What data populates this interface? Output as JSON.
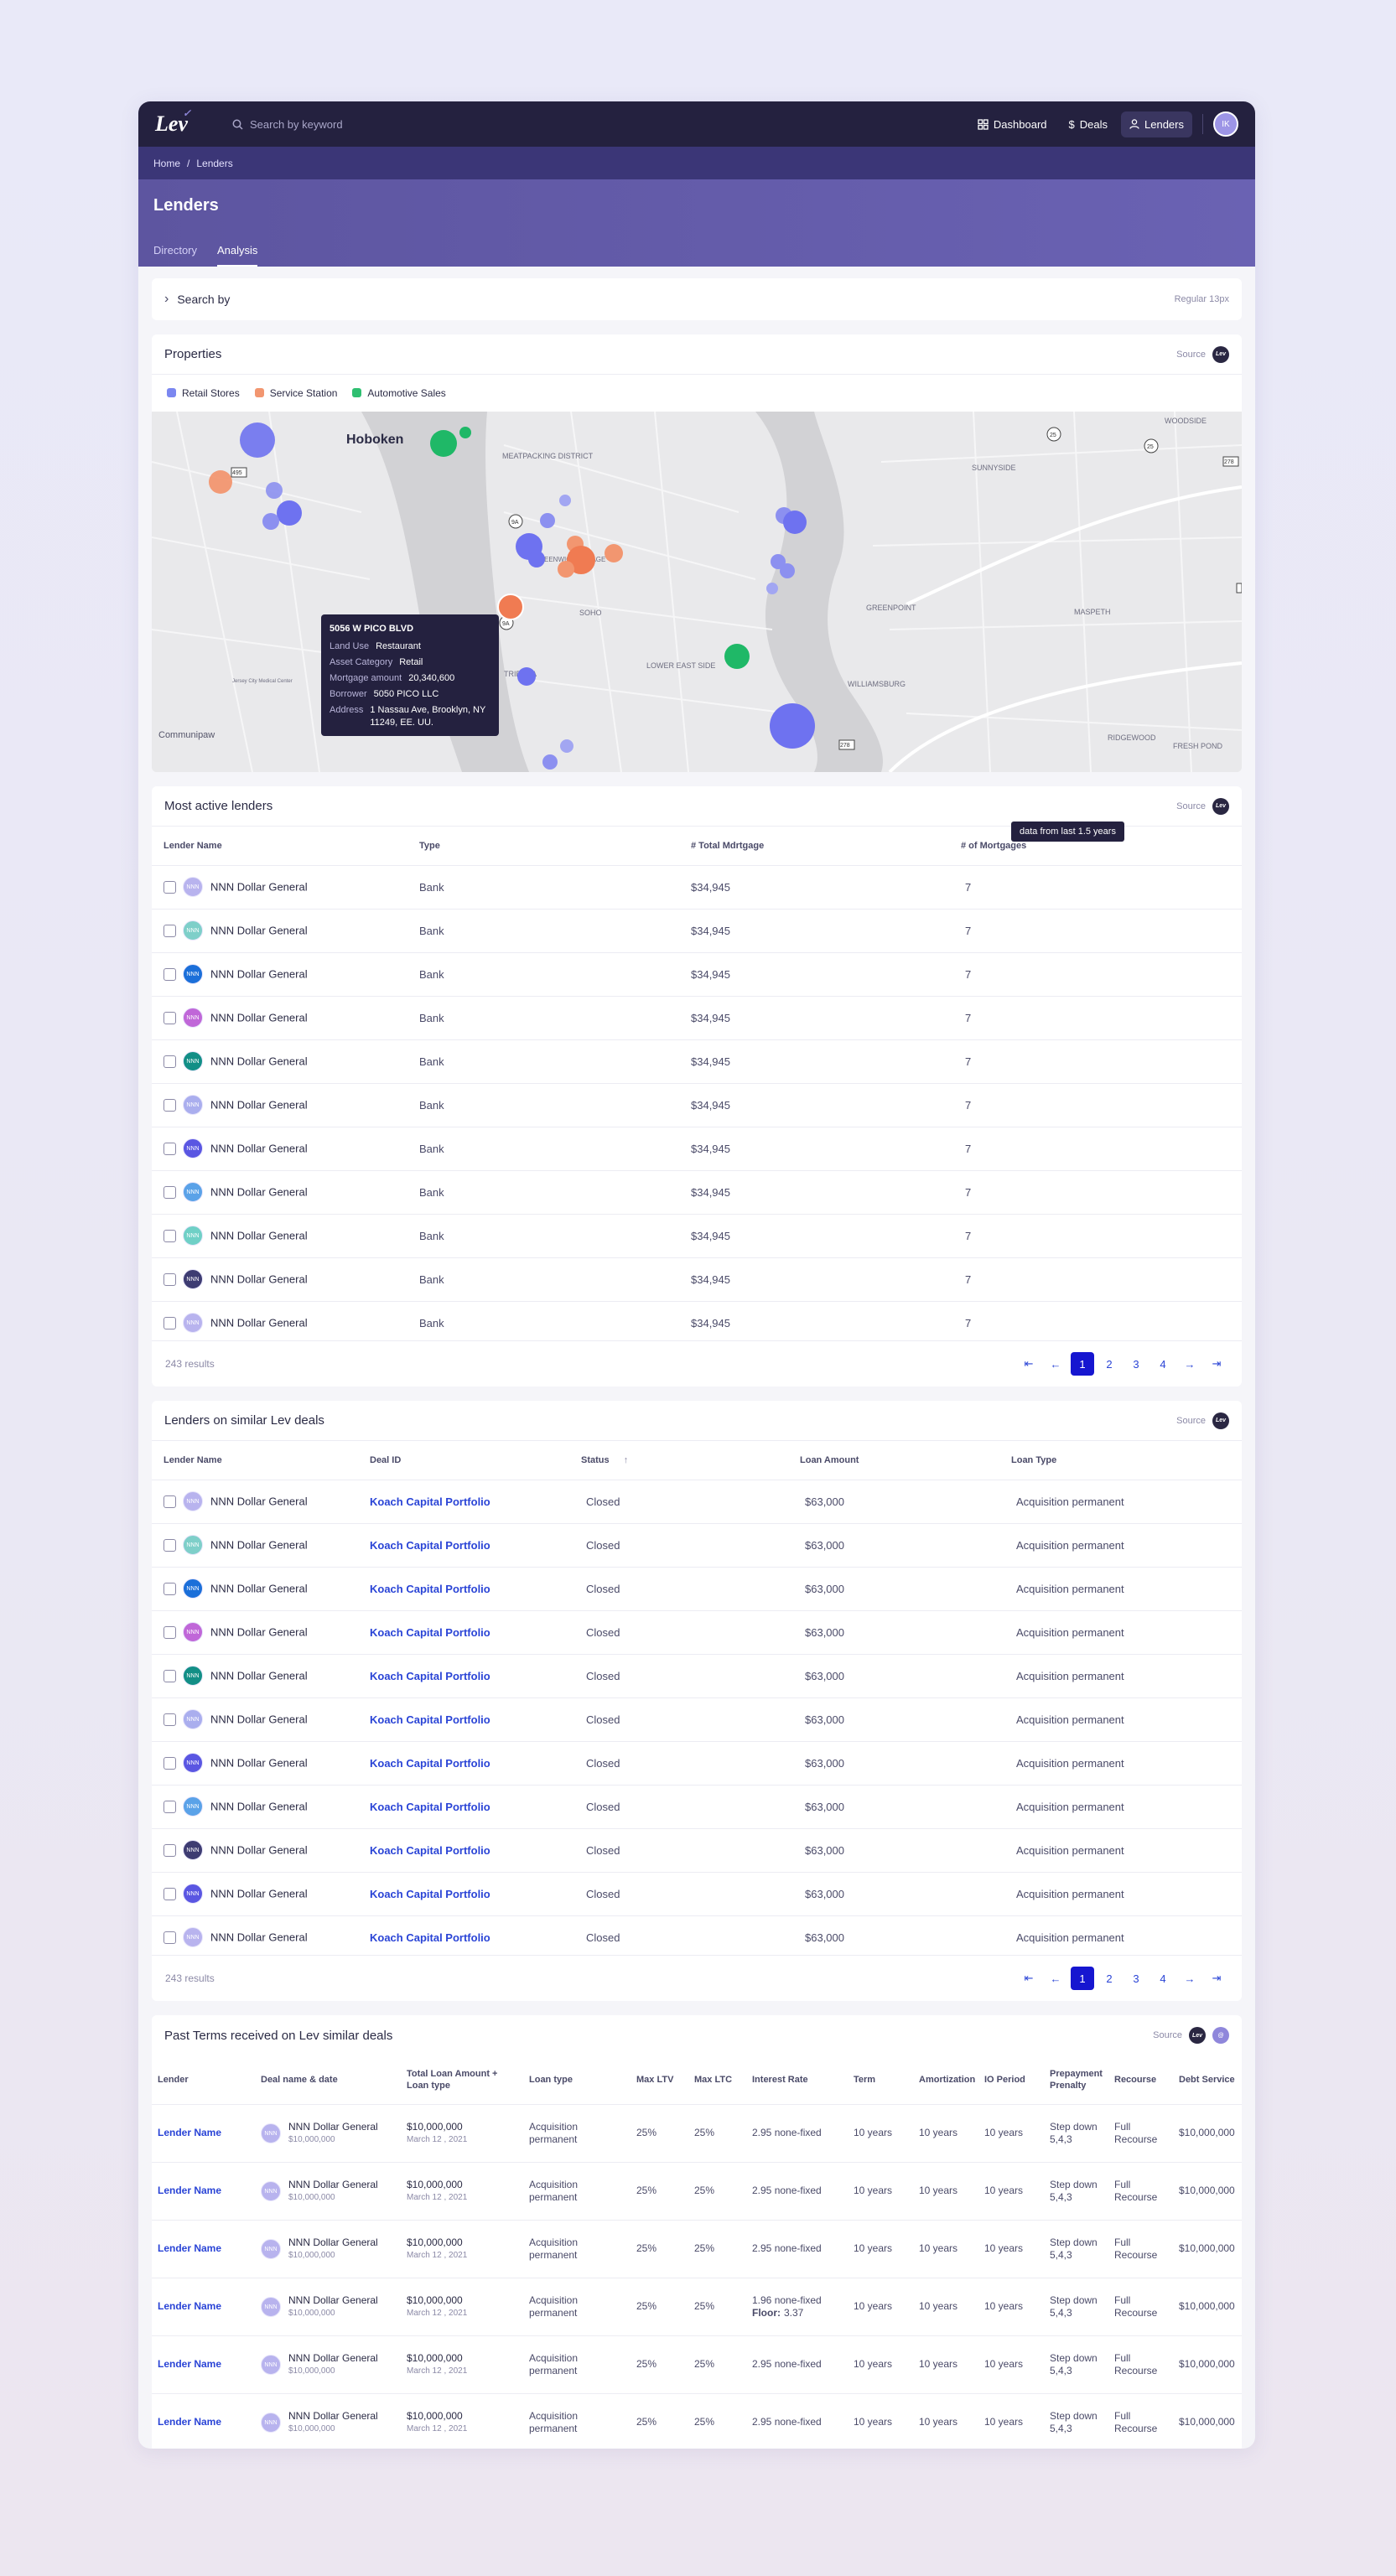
{
  "app": {
    "logo": "Lev",
    "search_placeholder": "Search by keyword",
    "nav": [
      {
        "label": "Dashboard",
        "icon": "grid-icon"
      },
      {
        "label": "Deals",
        "icon": "dollar-icon"
      },
      {
        "label": "Lenders",
        "icon": "user-icon",
        "active": true
      }
    ],
    "avatar_initials": "IK"
  },
  "breadcrumb": {
    "home": "Home",
    "sep": "/",
    "current": "Lenders"
  },
  "page": {
    "title": "Lenders",
    "tabs": [
      "Directory",
      "Analysis"
    ],
    "active_tab": "Analysis"
  },
  "search_by": {
    "label": "Search by",
    "hint": "Regular 13px"
  },
  "properties": {
    "title": "Properties",
    "source": "Source",
    "legend": [
      {
        "label": "Retail Stores",
        "color": "#7b87f0"
      },
      {
        "label": "Service Station",
        "color": "#f29670"
      },
      {
        "label": "Automotive Sales",
        "color": "#2fbf71"
      }
    ],
    "map_labels": [
      "Hoboken",
      "MEATPACKING DISTRICT",
      "SOHO",
      "LOWER EAST SIDE",
      "GREENPOINT",
      "MASPETH",
      "SUNNYSIDE",
      "WOODSIDE",
      "WILLIAMSBURG",
      "RIDGEWOOD",
      "FRESH POND",
      "Communipaw",
      "TRIBECA",
      "GREENWICH VILLAGE",
      "Jersey City Medical Center"
    ],
    "road_badges": [
      "25",
      "25",
      "9A",
      "9A",
      "495",
      "278",
      "278",
      "495"
    ],
    "popup": {
      "title": "5056 W PICO BLVD",
      "rows": [
        {
          "k": "Land Use",
          "v": "Restaurant"
        },
        {
          "k": "Asset Category",
          "v": "Retail"
        },
        {
          "k": "Mortgage amount",
          "v": "20,340,600"
        },
        {
          "k": "Borrower",
          "v": "5050 PICO LLC"
        },
        {
          "k": "Address",
          "v": "1 Nassau Ave, Brooklyn, NY 11249, EE. UU."
        }
      ]
    }
  },
  "active_lenders": {
    "title": "Most active lenders",
    "source": "Source",
    "tooltip": "data from last 1.5 years",
    "columns": [
      "Lender Name",
      "Type",
      "# Total Mdrtgage",
      "# of Mortgages"
    ],
    "rows": [
      {
        "name": "NNN Dollar General",
        "type": "Bank",
        "total": "$34,945",
        "count": "7",
        "color": "#b8b3ee"
      },
      {
        "name": "NNN Dollar General",
        "type": "Bank",
        "total": "$34,945",
        "count": "7",
        "color": "#7ecfc9"
      },
      {
        "name": "NNN Dollar General",
        "type": "Bank",
        "total": "$34,945",
        "count": "7",
        "color": "#1b6fd9"
      },
      {
        "name": "NNN Dollar General",
        "type": "Bank",
        "total": "$34,945",
        "count": "7",
        "color": "#c067d8"
      },
      {
        "name": "NNN Dollar General",
        "type": "Bank",
        "total": "$34,945",
        "count": "7",
        "color": "#128f86"
      },
      {
        "name": "NNN Dollar General",
        "type": "Bank",
        "total": "$34,945",
        "count": "7",
        "color": "#aaaeee"
      },
      {
        "name": "NNN Dollar General",
        "type": "Bank",
        "total": "$34,945",
        "count": "7",
        "color": "#5a56e2"
      },
      {
        "name": "NNN Dollar General",
        "type": "Bank",
        "total": "$34,945",
        "count": "7",
        "color": "#5aa2e8"
      },
      {
        "name": "NNN Dollar General",
        "type": "Bank",
        "total": "$34,945",
        "count": "7",
        "color": "#6fd0c6"
      },
      {
        "name": "NNN Dollar General",
        "type": "Bank",
        "total": "$34,945",
        "count": "7",
        "color": "#3e3c72"
      },
      {
        "name": "NNN Dollar General",
        "type": "Bank",
        "total": "$34,945",
        "count": "7",
        "color": "#b8b3ee"
      }
    ],
    "results": "243 results",
    "pages": [
      "1",
      "2",
      "3",
      "4"
    ]
  },
  "similar_deals": {
    "title": "Lenders on similar Lev deals",
    "source": "Source",
    "columns": [
      "Lender Name",
      "Deal ID",
      "Status",
      "Loan Amount",
      "Loan Type"
    ],
    "rows": [
      {
        "name": "NNN Dollar General",
        "deal": "Koach Capital Portfolio",
        "status": "Closed",
        "amount": "$63,000",
        "type": "Acquisition permanent",
        "color": "#b8b3ee"
      },
      {
        "name": "NNN Dollar General",
        "deal": "Koach Capital Portfolio",
        "status": "Closed",
        "amount": "$63,000",
        "type": "Acquisition permanent",
        "color": "#7ecfc9"
      },
      {
        "name": "NNN Dollar General",
        "deal": "Koach Capital Portfolio",
        "status": "Closed",
        "amount": "$63,000",
        "type": "Acquisition permanent",
        "color": "#1b6fd9"
      },
      {
        "name": "NNN Dollar General",
        "deal": "Koach Capital Portfolio",
        "status": "Closed",
        "amount": "$63,000",
        "type": "Acquisition permanent",
        "color": "#c067d8"
      },
      {
        "name": "NNN Dollar General",
        "deal": "Koach Capital Portfolio",
        "status": "Closed",
        "amount": "$63,000",
        "type": "Acquisition permanent",
        "color": "#128f86"
      },
      {
        "name": "NNN Dollar General",
        "deal": "Koach Capital Portfolio",
        "status": "Closed",
        "amount": "$63,000",
        "type": "Acquisition permanent",
        "color": "#aaaeee"
      },
      {
        "name": "NNN Dollar General",
        "deal": "Koach Capital Portfolio",
        "status": "Closed",
        "amount": "$63,000",
        "type": "Acquisition permanent",
        "color": "#5a56e2"
      },
      {
        "name": "NNN Dollar General",
        "deal": "Koach Capital Portfolio",
        "status": "Closed",
        "amount": "$63,000",
        "type": "Acquisition permanent",
        "color": "#5aa2e8"
      },
      {
        "name": "NNN Dollar General",
        "deal": "Koach Capital Portfolio",
        "status": "Closed",
        "amount": "$63,000",
        "type": "Acquisition permanent",
        "color": "#3e3c72"
      },
      {
        "name": "NNN Dollar General",
        "deal": "Koach Capital Portfolio",
        "status": "Closed",
        "amount": "$63,000",
        "type": "Acquisition permanent",
        "color": "#5a56e2"
      },
      {
        "name": "NNN Dollar General",
        "deal": "Koach Capital Portfolio",
        "status": "Closed",
        "amount": "$63,000",
        "type": "Acquisition permanent",
        "color": "#b8b3ee"
      }
    ],
    "results": "243 results",
    "pages": [
      "1",
      "2",
      "3",
      "4"
    ]
  },
  "past_terms": {
    "title": "Past Terms received on Lev similar deals",
    "source": "Source",
    "columns": [
      "Lender",
      "Deal name & date",
      "Total Loan Amount + Loan type",
      "Loan type",
      "Max LTV",
      "Max LTC",
      "Interest Rate",
      "Term",
      "Amortization",
      "IO Period",
      "Prepayment Prenalty",
      "Recourse",
      "Debt Service"
    ],
    "rows": [
      {
        "lender": "Lender Name",
        "deal": "NNN Dollar General",
        "deal_amt": "$10,000,000",
        "total": "$10,000,000",
        "date": "March 12 , 2021",
        "loan_type": "Acquisition permanent",
        "ltv": "25%",
        "ltc": "25%",
        "rate": "2.95 none-fixed",
        "floor_label": "",
        "floor": "",
        "term": "10 years",
        "amort": "10 years",
        "io": "10 years",
        "prepay": "Step down 5,4,3",
        "recourse": "Full Recourse",
        "debt": "$10,000,000"
      },
      {
        "lender": "Lender Name",
        "deal": "NNN Dollar General",
        "deal_amt": "$10,000,000",
        "total": "$10,000,000",
        "date": "March 12 , 2021",
        "loan_type": "Acquisition permanent",
        "ltv": "25%",
        "ltc": "25%",
        "rate": "2.95 none-fixed",
        "floor_label": "",
        "floor": "",
        "term": "10 years",
        "amort": "10 years",
        "io": "10 years",
        "prepay": "Step down 5,4,3",
        "recourse": "Full Recourse",
        "debt": "$10,000,000"
      },
      {
        "lender": "Lender Name",
        "deal": "NNN Dollar General",
        "deal_amt": "$10,000,000",
        "total": "$10,000,000",
        "date": "March 12 , 2021",
        "loan_type": "Acquisition permanent",
        "ltv": "25%",
        "ltc": "25%",
        "rate": "2.95 none-fixed",
        "floor_label": "",
        "floor": "",
        "term": "10 years",
        "amort": "10 years",
        "io": "10 years",
        "prepay": "Step down 5,4,3",
        "recourse": "Full Recourse",
        "debt": "$10,000,000"
      },
      {
        "lender": "Lender Name",
        "deal": "NNN Dollar General",
        "deal_amt": "$10,000,000",
        "total": "$10,000,000",
        "date": "March 12 , 2021",
        "loan_type": "Acquisition permanent",
        "ltv": "25%",
        "ltc": "25%",
        "rate": "1.96 none-fixed",
        "floor_label": "Floor:",
        "floor": "3.37",
        "term": "10 years",
        "amort": "10 years",
        "io": "10 years",
        "prepay": "Step down 5,4,3",
        "recourse": "Full Recourse",
        "debt": "$10,000,000"
      },
      {
        "lender": "Lender Name",
        "deal": "NNN Dollar General",
        "deal_amt": "$10,000,000",
        "total": "$10,000,000",
        "date": "March 12 , 2021",
        "loan_type": "Acquisition permanent",
        "ltv": "25%",
        "ltc": "25%",
        "rate": "2.95 none-fixed",
        "floor_label": "",
        "floor": "",
        "term": "10 years",
        "amort": "10 years",
        "io": "10 years",
        "prepay": "Step down 5,4,3",
        "recourse": "Full Recourse",
        "debt": "$10,000,000"
      },
      {
        "lender": "Lender Name",
        "deal": "NNN Dollar General",
        "deal_amt": "$10,000,000",
        "total": "$10,000,000",
        "date": "March 12 , 2021",
        "loan_type": "Acquisition permanent",
        "ltv": "25%",
        "ltc": "25%",
        "rate": "2.95 none-fixed",
        "floor_label": "",
        "floor": "",
        "term": "10 years",
        "amort": "10 years",
        "io": "10 years",
        "prepay": "Step down 5,4,3",
        "recourse": "Full Recourse",
        "debt": "$10,000,000"
      }
    ]
  }
}
